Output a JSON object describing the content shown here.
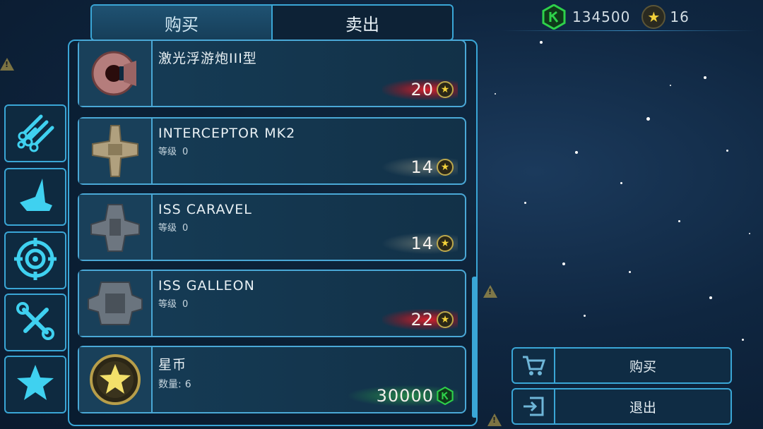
{
  "tabs": {
    "buy": "购买",
    "sell": "卖出"
  },
  "currency": {
    "cash": "134500",
    "stars": "16",
    "cash_icon": "green-hex-coin-icon",
    "star_icon": "star-icon"
  },
  "side_menu": [
    {
      "icon": "ammo-bundle-icon"
    },
    {
      "icon": "ship-hull-icon"
    },
    {
      "icon": "target-crosshair-icon"
    },
    {
      "icon": "wrench-screwdriver-icon"
    },
    {
      "icon": "star-icon"
    }
  ],
  "items": [
    {
      "name": "激光浮游炮III型",
      "level_label": "",
      "level": "",
      "price": "20",
      "currency": "star",
      "glow": "#e01e28"
    },
    {
      "name": "INTERCEPTOR MK2",
      "level_label": "等级",
      "level": "0",
      "price": "14",
      "currency": "star",
      "glow": "#d8d0aa"
    },
    {
      "name": "ISS CARAVEL",
      "level_label": "等级",
      "level": "0",
      "price": "14",
      "currency": "star",
      "glow": "#d8d0aa"
    },
    {
      "name": "ISS GALLEON",
      "level_label": "等级",
      "level": "0",
      "price": "22",
      "currency": "star",
      "glow": "#e01e28"
    },
    {
      "name": "星币",
      "level_label": "数量:",
      "level": "6",
      "price": "30000",
      "currency": "cash",
      "glow": "#32c846"
    }
  ],
  "actions": {
    "buy": "购买",
    "exit": "退出"
  },
  "colors": {
    "accent": "#3aa6d6",
    "gold": "#f4d23a",
    "green": "#2ed14a",
    "red": "#e01e28"
  }
}
